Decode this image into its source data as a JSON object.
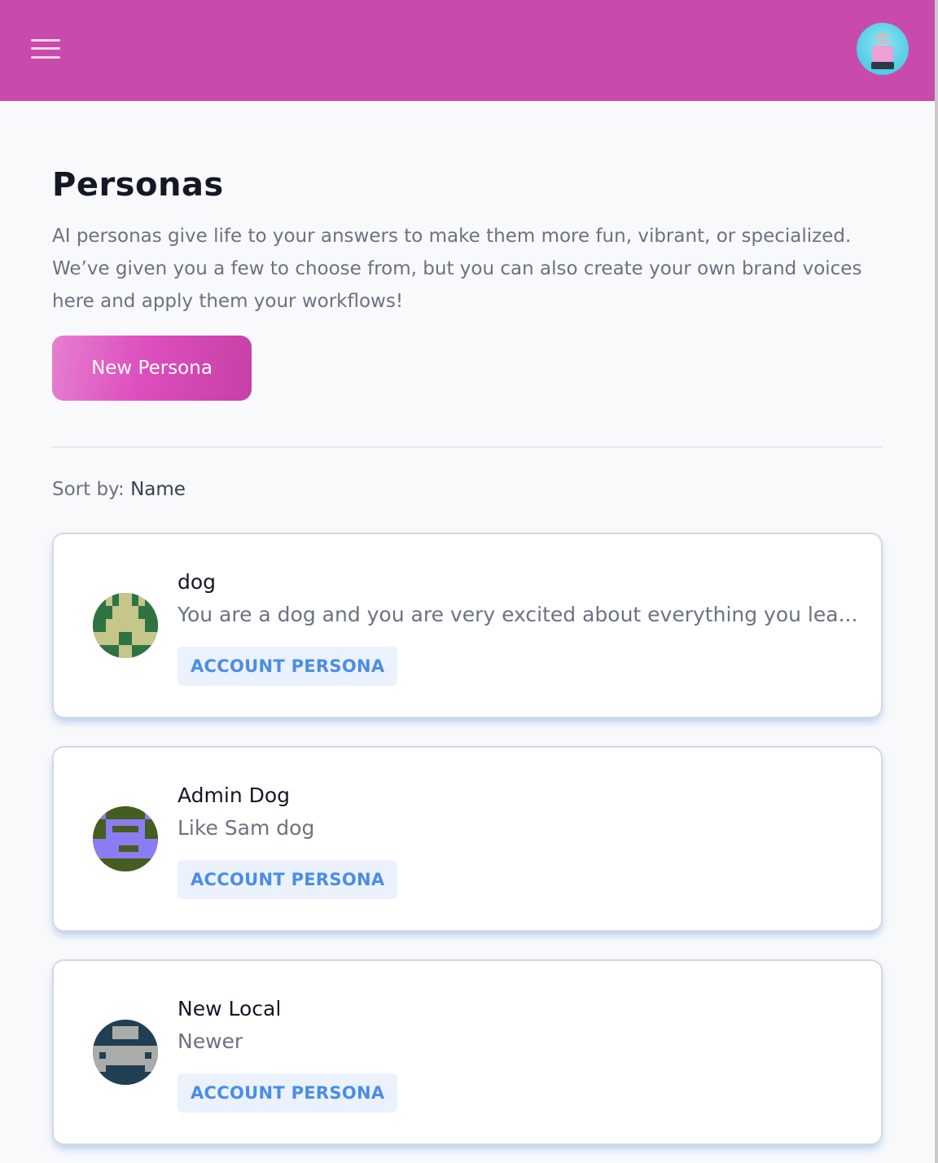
{
  "header": {
    "menu_icon": "hamburger-menu-icon",
    "user_avatar": "robot-avatar",
    "brand_color": "#c84aab"
  },
  "page": {
    "title": "Personas",
    "description": "AI personas give life to your answers to make them more fun, vibrant, or specialized. We’ve given you a few to choose from, but you can also create your own brand voices here and apply them your workflows!",
    "new_button_label": "New Persona",
    "sort_label": "Sort by:",
    "sort_value": "Name"
  },
  "personas": [
    {
      "name": "dog",
      "description": "You are a dog and you are very excited about everything you lea...",
      "badge": "ACCOUNT PERSONA",
      "avatar_colors": {
        "bg": "#2f7343",
        "fg": "#c6c58a"
      },
      "avatar_pattern": [
        "0010110100",
        "0010110100",
        "0001111000",
        "0001111000",
        "0011111100",
        "0011111100",
        "1111001111",
        "1111001111",
        "0000110000",
        "0000110000"
      ]
    },
    {
      "name": "Admin Dog",
      "description": "Like Sam dog",
      "badge": "ACCOUNT PERSONA",
      "avatar_colors": {
        "bg": "#445e22",
        "fg": "#8b7cf1"
      },
      "avatar_pattern": [
        "1100000011",
        "1100000011",
        "0011111100",
        "0010000100",
        "0011111100",
        "1111111111",
        "1111000111",
        "1111111111",
        "0000000000",
        "0000000000"
      ]
    },
    {
      "name": "New Local",
      "description": "Newer",
      "badge": "ACCOUNT PERSONA",
      "avatar_colors": {
        "bg": "#213f52",
        "fg": "#aaaca9"
      },
      "avatar_pattern": [
        "0000000000",
        "0001111000",
        "0001111000",
        "0000000000",
        "1111111111",
        "1011111101",
        "1111111111",
        "1100000011",
        "0000000000",
        "0000000000"
      ]
    }
  ]
}
